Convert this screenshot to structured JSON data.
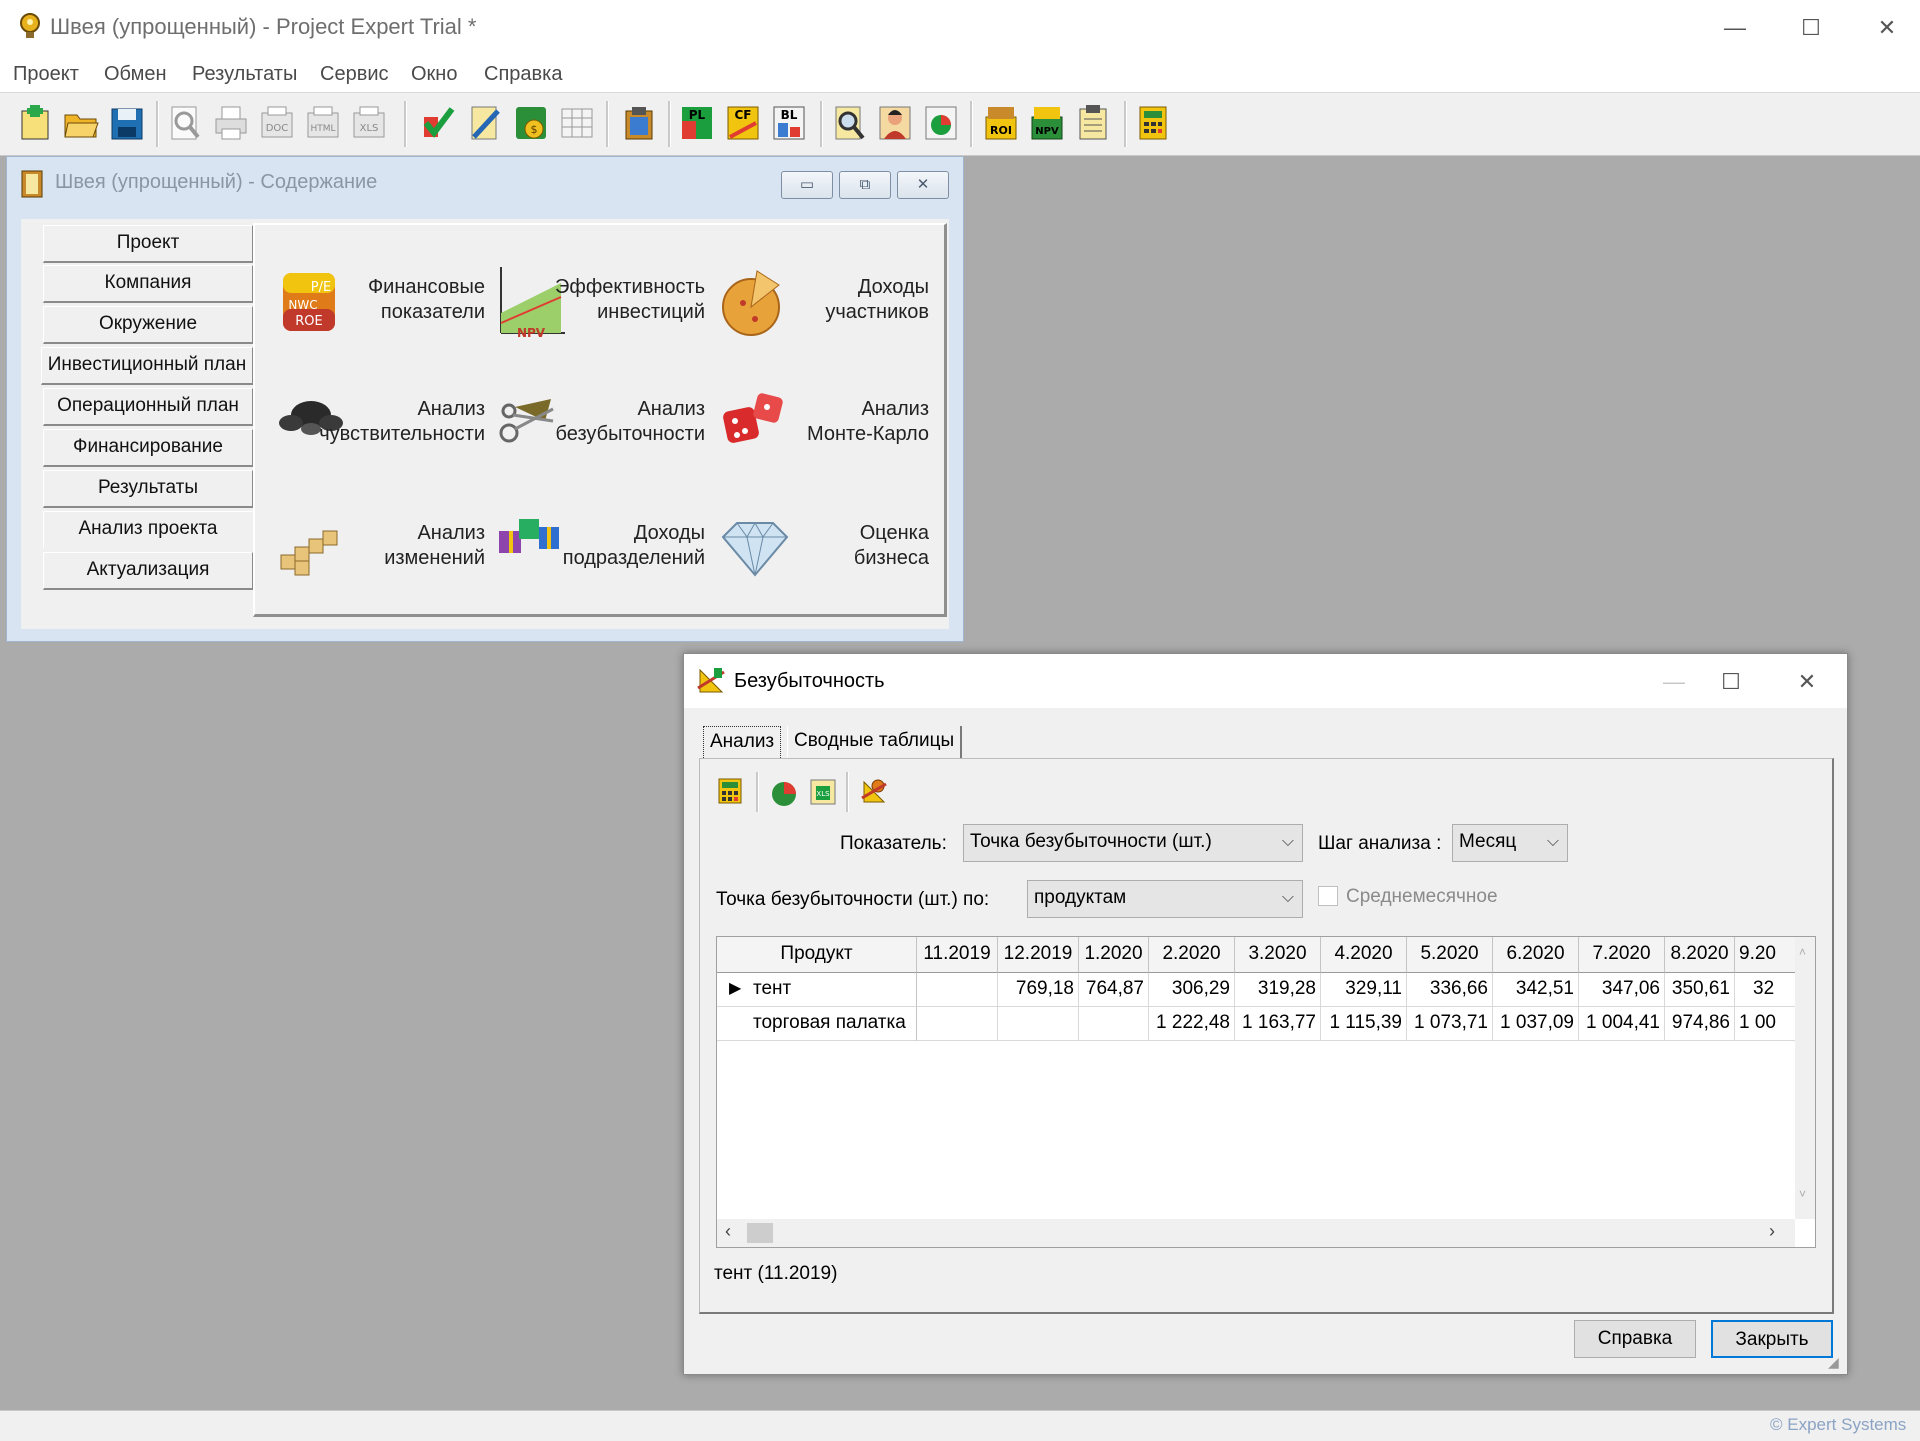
{
  "app": {
    "title": "Швея (упрощенный) - Project Expert Trial *",
    "window_controls": [
      "—",
      "☐",
      "✕"
    ]
  },
  "menu": [
    "Проект",
    "Обмен",
    "Результаты",
    "Сервис",
    "Окно",
    "Справка"
  ],
  "toolbar": {
    "icons": [
      "new-project-icon",
      "open-icon",
      "save-icon",
      "preview-icon",
      "print-icon",
      "export-doc-icon",
      "export-html-icon",
      "export-xls-icon",
      "check-icon",
      "edit-icon",
      "calculate-icon",
      "table-icon",
      "clipboard-icon",
      "pl-report-icon",
      "cf-report-icon",
      "bl-report-icon",
      "zoom-icon",
      "person-icon",
      "chart-icon",
      "roi-icon",
      "npv-icon",
      "notes-icon",
      "calculator-icon"
    ],
    "labels": {
      "pl": "PL",
      "cf": "CF",
      "bl": "BL",
      "roi": "ROI",
      "npv": "NPV",
      "doc": "DOC",
      "html": "HTML",
      "xls": "XLS"
    }
  },
  "contents_window": {
    "title": "Швея (упрощенный) - Содержание",
    "nav": [
      "Проект",
      "Компания",
      "Окружение",
      "Инвестиционный план",
      "Операционный план",
      "Финансирование",
      "Результаты",
      "Анализ проекта",
      "Актуализация"
    ],
    "tiles": [
      {
        "line1": "Финансовые",
        "line2": "показатели"
      },
      {
        "line1": "Эффективность",
        "line2": "инвестиций"
      },
      {
        "line1": "Доходы",
        "line2": "участников"
      },
      {
        "line1": "Анализ",
        "line2": "чувствительности"
      },
      {
        "line1": "Анализ",
        "line2": "безубыточности"
      },
      {
        "line1": "Анализ",
        "line2": "Монте-Карло"
      },
      {
        "line1": "Анализ",
        "line2": "изменений"
      },
      {
        "line1": "Доходы",
        "line2": "подразделений"
      },
      {
        "line1": "Оценка",
        "line2": "бизнеса"
      }
    ],
    "icon_text": {
      "pe": "P/E",
      "nwc": "NWC",
      "roe": "ROE",
      "npv": "NPV"
    }
  },
  "breakeven": {
    "title": "Безубыточность",
    "tabs": [
      "Анализ",
      "Сводные таблицы"
    ],
    "indicator_label": "Показатель:",
    "indicator_value": "Точка безубыточности (шт.)",
    "step_label": "Шаг анализа :",
    "step_value": "Месяц",
    "by_label": "Точка безубыточности (шт.) по:",
    "by_value": "продуктам",
    "avg_label": "Среднемесячное",
    "columns": [
      "Продукт",
      "11.2019",
      "12.2019",
      "1.2020",
      "2.2020",
      "3.2020",
      "4.2020",
      "5.2020",
      "6.2020",
      "7.2020",
      "8.2020",
      "9.20"
    ],
    "rows": [
      {
        "name": "тент",
        "values": [
          "",
          "769,18",
          "764,87",
          "306,29",
          "319,28",
          "329,11",
          "336,66",
          "342,51",
          "347,06",
          "350,61",
          "32"
        ]
      },
      {
        "name": "торговая палатка",
        "values": [
          "",
          "",
          "",
          "1 222,48",
          "1 163,77",
          "1 115,39",
          "1 073,71",
          "1 037,09",
          "1 004,41",
          "974,86",
          "1 00"
        ]
      }
    ],
    "status": "тент (11.2019)",
    "help_button": "Справка",
    "close_button": "Закрыть"
  },
  "footer": {
    "copyright": "© Expert Systems"
  }
}
